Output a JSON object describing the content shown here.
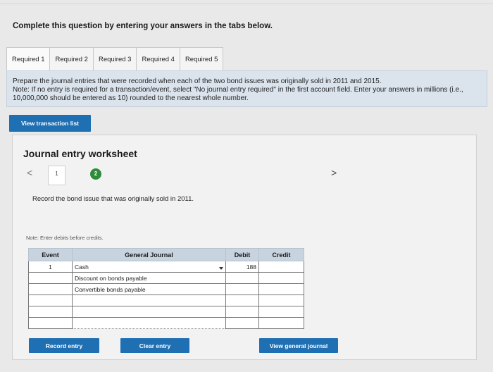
{
  "question": {
    "title": "Complete this question by entering your answers in the tabs below."
  },
  "tabs": [
    {
      "label": "Required 1"
    },
    {
      "label": "Required 2"
    },
    {
      "label": "Required 3"
    },
    {
      "label": "Required 4"
    },
    {
      "label": "Required 5"
    }
  ],
  "instructions": {
    "line1": "Prepare the journal entries that were recorded when each of the two bond issues was originally sold in 2011 and 2015.",
    "line2": "Note: If no entry is required for a transaction/event, select \"No journal entry required\" in the first account field. Enter your answers in millions (i.e., 10,000,000 should be entered as 10) rounded to the nearest whole number."
  },
  "buttons": {
    "view_transaction": "View transaction list",
    "record": "Record entry",
    "clear": "Clear entry",
    "view_journal": "View general journal"
  },
  "worksheet": {
    "title": "Journal entry worksheet",
    "prev": "<",
    "next": ">",
    "step1": "1",
    "step2": "2",
    "record_text": "Record the bond issue that was originally sold in 2011.",
    "note": "Note: Enter debits before credits."
  },
  "table": {
    "headers": {
      "event": "Event",
      "journal": "General Journal",
      "debit": "Debit",
      "credit": "Credit"
    },
    "rows": [
      {
        "event": "1",
        "account": "Cash",
        "debit": "188",
        "credit": ""
      },
      {
        "event": "",
        "account": "Discount on bonds payable",
        "debit": "",
        "credit": ""
      },
      {
        "event": "",
        "account": "Convertible bonds payable",
        "debit": "",
        "credit": ""
      },
      {
        "event": "",
        "account": "",
        "debit": "",
        "credit": ""
      },
      {
        "event": "",
        "account": "",
        "debit": "",
        "credit": ""
      },
      {
        "event": "",
        "account": "",
        "debit": "",
        "credit": ""
      }
    ]
  }
}
